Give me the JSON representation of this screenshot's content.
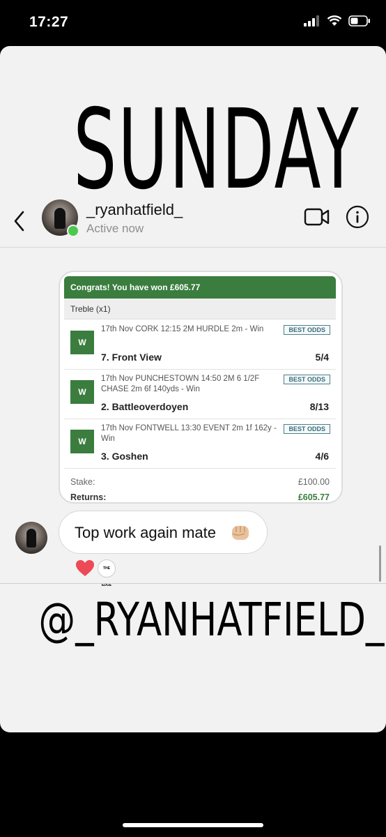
{
  "status_bar": {
    "time": "17:27"
  },
  "story": {
    "overlay_title": "SUNDAY",
    "overlay_handle": "@_RYANHATFIELD_"
  },
  "chat_header": {
    "username": "_ryanhatfield_",
    "status": "Active now"
  },
  "bet_slip": {
    "congrats": "Congrats! You have won £605.77",
    "bet_type": "Treble (x1)",
    "selections": [
      {
        "badge": "W",
        "description": "17th Nov CORK 12:15 2M HURDLE 2m - Win",
        "tag": "BEST ODDS",
        "name": "7. Front View",
        "odds": "5/4"
      },
      {
        "badge": "W",
        "description": "17th Nov PUNCHESTOWN 14:50 2M 6 1/2F CHASE 2m 6f 140yds - Win",
        "tag": "BEST ODDS",
        "name": "2. Battleoverdoyen",
        "odds": "8/13"
      },
      {
        "badge": "W",
        "description": "17th Nov FONTWELL 13:30 EVENT 2m 1f 162y - Win",
        "tag": "BEST ODDS",
        "name": "3. Goshen",
        "odds": "4/6"
      }
    ],
    "stake_label": "Stake:",
    "stake_value": "£100.00",
    "returns_label": "Returns:",
    "returns_value": "£605.77"
  },
  "message": {
    "text": "Top work again mate"
  },
  "reactions": {
    "avatar_text": "THE EDGE"
  },
  "colors": {
    "accent_green": "#3a7d3e",
    "online": "#4cc94c",
    "heart": "#ed4956"
  }
}
